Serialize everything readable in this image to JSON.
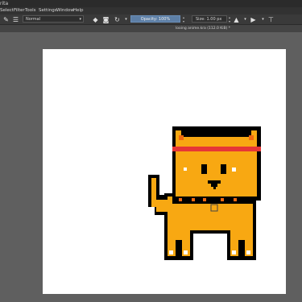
{
  "app": {
    "title": "rita"
  },
  "menu": [
    "Select",
    "Filter",
    "Tools",
    "Settings",
    "Window",
    "Help"
  ],
  "toolbar": {
    "blend_mode": "Normal",
    "opacity_label": "Opacity: 100%",
    "size_label": "Size: 1.00 px"
  },
  "document": {
    "tab_label": "looing anime.kra (112.0 KiB) *"
  },
  "colors": {
    "fur": "#f8a812",
    "outline": "#000000",
    "headband": "#e63636",
    "ear_inner": "#f06a10",
    "canvas": "#ffffff",
    "workspace": "#5f5f5f"
  }
}
